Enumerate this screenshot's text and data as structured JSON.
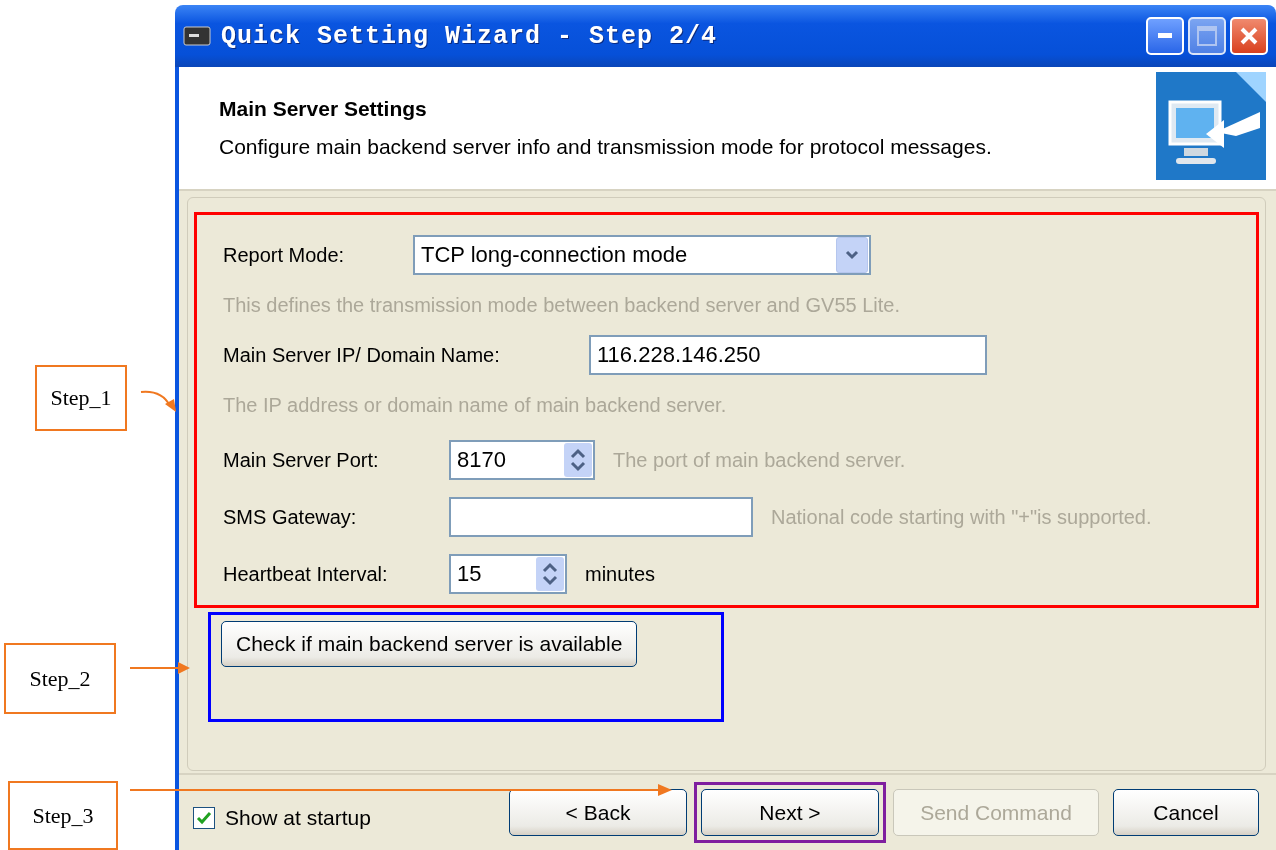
{
  "annotations": [
    {
      "label": "Step_1"
    },
    {
      "label": "Step_2"
    },
    {
      "label": "Step_3"
    }
  ],
  "window": {
    "title": "Quick Setting Wizard - Step 2/4"
  },
  "header": {
    "title": "Main Server Settings",
    "description": "Configure main backend server info and transmission mode for protocol messages."
  },
  "form": {
    "rows": [
      {
        "kind": "select",
        "label": "Report Mode:",
        "value": "TCP long-connection mode"
      },
      {
        "kind": "hint",
        "text": "This defines the transmission mode between backend server and GV55 Lite."
      },
      {
        "kind": "text",
        "label": "Main Server IP/ Domain Name:",
        "value": "116.228.146.250"
      },
      {
        "kind": "hint",
        "text": "The IP address or domain name of main backend server."
      },
      {
        "kind": "spin",
        "label": "Main Server Port:",
        "value": "8170",
        "note": "The port of main backend server."
      },
      {
        "kind": "text",
        "label": "SMS Gateway:",
        "note": "National code starting with \"+\"is supported."
      },
      {
        "kind": "spin",
        "label": "Heartbeat Interval:",
        "value": "15",
        "unit": "minutes"
      }
    ]
  },
  "check_button": {
    "label": "Check if main backend server is available"
  },
  "footer": {
    "show_at_startup": {
      "label": "Show at startup",
      "checked": true
    },
    "buttons": [
      {
        "label": "< Back",
        "disabled": false,
        "highlighted": false
      },
      {
        "label": "Next >",
        "disabled": false,
        "highlighted": true
      },
      {
        "label": "Send Command",
        "disabled": true,
        "highlighted": false
      },
      {
        "label": "Cancel",
        "disabled": false,
        "highlighted": false
      }
    ]
  }
}
